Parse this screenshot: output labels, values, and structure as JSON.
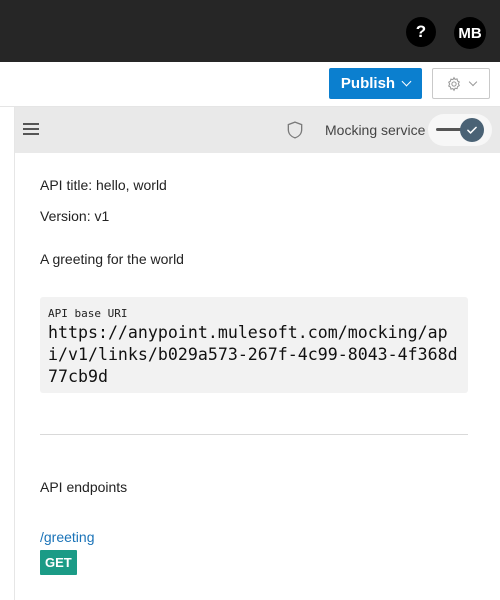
{
  "topbar": {
    "help_label": "?",
    "avatar_initials": "MB"
  },
  "toolbar": {
    "publish_label": "Publish",
    "settings_icon": "gear-icon"
  },
  "panel": {
    "menu_icon": "hamburger-icon",
    "shield_icon": "shield-icon",
    "mocking_label": "Mocking service",
    "mocking_enabled": true
  },
  "api": {
    "title_line": "API title: hello, world",
    "version_line": "Version: v1",
    "description": "A greeting for the world",
    "base_uri_label": "API base URI",
    "base_uri": "https://anypoint.mulesoft.com/mocking/api/v1/links/b029a573-267f-4c99-8043-4f368d77cb9d",
    "endpoints_heading": "API endpoints",
    "endpoints": [
      {
        "path": "/greeting",
        "methods": [
          "GET"
        ]
      }
    ]
  },
  "colors": {
    "topbar_bg": "#262626",
    "publish_bg": "#0b7fcf",
    "link": "#1a73b8",
    "get_badge": "#1b9b86",
    "toggle_knob": "#4a6275"
  }
}
